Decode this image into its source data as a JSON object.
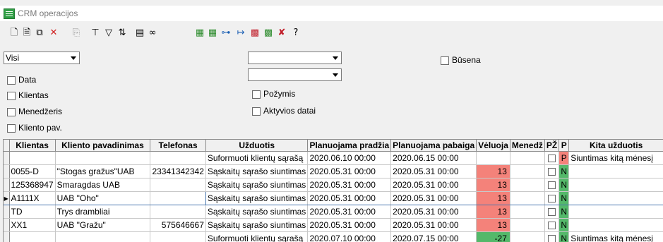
{
  "window": {
    "title": "CRM operacijos"
  },
  "toolbar": {
    "left_icons": [
      {
        "name": "new-document-icon",
        "glyph": "🗋",
        "color": "#000000"
      },
      {
        "name": "open-document-icon",
        "glyph": "🗎",
        "color": "#000000"
      },
      {
        "name": "network-icon",
        "glyph": "⧉",
        "color": "#000000"
      },
      {
        "name": "delete-icon",
        "glyph": "✕",
        "color": "#d02020"
      },
      {
        "name": "copy-icon",
        "glyph": "⎘",
        "color": "#9a9a9a"
      },
      {
        "name": "hierarchy-icon",
        "glyph": "⊤",
        "color": "#000000"
      },
      {
        "name": "filter-icon",
        "glyph": "▽",
        "color": "#000000"
      },
      {
        "name": "sort-az-icon",
        "glyph": "⇅",
        "color": "#000000"
      },
      {
        "name": "print-icon",
        "glyph": "▤",
        "color": "#000000"
      },
      {
        "name": "binoculars-icon",
        "glyph": "∞",
        "color": "#000000"
      }
    ],
    "right_icons": [
      {
        "name": "add-record-icon",
        "glyph": "▦",
        "color": "#2a8a2a"
      },
      {
        "name": "add-record-2-icon",
        "glyph": "▦",
        "color": "#2a8a2a"
      },
      {
        "name": "link-records-icon",
        "glyph": "⊶",
        "color": "#1a5fb4"
      },
      {
        "name": "arrow-table-icon",
        "glyph": "↦",
        "color": "#1a5fb4"
      },
      {
        "name": "calendar-red-icon",
        "glyph": "▩",
        "color": "#c01c28"
      },
      {
        "name": "calendar-green-icon",
        "glyph": "▩",
        "color": "#2a8a2a"
      },
      {
        "name": "cancel-check-icon",
        "glyph": "✘",
        "color": "#c01c28"
      },
      {
        "name": "help-icon",
        "glyph": "?",
        "color": "#000000"
      }
    ]
  },
  "filters": {
    "period_value": "Visi",
    "combo_a_value": "",
    "combo_b_value": "",
    "checks": {
      "data": "Data",
      "klientas": "Klientas",
      "menedzeris": "Menedžeris",
      "kliento_pav": "Kliento pav.",
      "pozymis": "Požymis",
      "aktyvios": "Aktyvios datai",
      "busena": "Būsena"
    }
  },
  "table": {
    "headers": [
      "Klientas",
      "Kliento pavadinimas",
      "Telefonas",
      "Užduotis",
      "Planuojama pradžia",
      "Planuojama pabaiga",
      "Vėluoja",
      "Menedž",
      "PŽ",
      "P",
      "Kita užduotis"
    ],
    "rows": [
      {
        "klientas": "",
        "pavadinimas": "",
        "telefonas": "",
        "uzduotis": "Suformuoti klientų sąrašą",
        "pradzia": "2020.06.10 00:00",
        "pabaiga": "2020.06.15 00:00",
        "veluoja": "",
        "menedzeris": "",
        "p": "P",
        "kita": "Siuntimas kitą mėnesį"
      },
      {
        "klientas": "0055-D",
        "pavadinimas": "\"Stogas gražus\"UAB",
        "telefonas": "23341342342",
        "uzduotis": "Sąskaitų sąrašo siuntimas",
        "pradzia": "2020.05.31 00:00",
        "pabaiga": "2020.05.31 00:00",
        "veluoja": "13",
        "menedzeris": "",
        "p": "N",
        "kita": ""
      },
      {
        "klientas": "125368947",
        "pavadinimas": "Smaragdas UAB",
        "telefonas": "",
        "uzduotis": "Sąskaitų sąrašo siuntimas",
        "pradzia": "2020.05.31 00:00",
        "pabaiga": "2020.05.31 00:00",
        "veluoja": "13",
        "menedzeris": "",
        "p": "N",
        "kita": ""
      },
      {
        "klientas": "A1111X",
        "pavadinimas": "UAB \"Oho\"",
        "telefonas": "",
        "uzduotis": "Sąskaitų sąrašo siuntimas",
        "pradzia": "2020.05.31 00:00",
        "pabaiga": "2020.05.31 00:00",
        "veluoja": "13",
        "menedzeris": "",
        "p": "N",
        "kita": ""
      },
      {
        "klientas": "TD",
        "pavadinimas": "Trys drambliai",
        "telefonas": "",
        "uzduotis": "Sąskaitų sąrašo siuntimas",
        "pradzia": "2020.05.31 00:00",
        "pabaiga": "2020.05.31 00:00",
        "veluoja": "13",
        "menedzeris": "",
        "p": "N",
        "kita": ""
      },
      {
        "klientas": "XX1",
        "pavadinimas": "UAB \"Gražu\"",
        "telefonas": "575646667",
        "uzduotis": "Sąskaitų sąrašo siuntimas",
        "pradzia": "2020.05.31 00:00",
        "pabaiga": "2020.05.31 00:00",
        "veluoja": "13",
        "menedzeris": "",
        "p": "N",
        "kita": ""
      },
      {
        "klientas": "",
        "pavadinimas": "",
        "telefonas": "",
        "uzduotis": "Suformuoti klientų sąrašą",
        "pradzia": "2020.07.10 00:00",
        "pabaiga": "2020.07.15 00:00",
        "veluoja": "-27",
        "menedzeris": "",
        "p": "N",
        "kita": "Siuntimas kitą mėnesį"
      }
    ],
    "selected_row": 3,
    "current_row_marker": "▶"
  },
  "colors": {
    "late_positive": "#f4827a",
    "late_negative": "#54b86a",
    "flag_P": "#f4827a",
    "flag_N": "#54b86a"
  }
}
